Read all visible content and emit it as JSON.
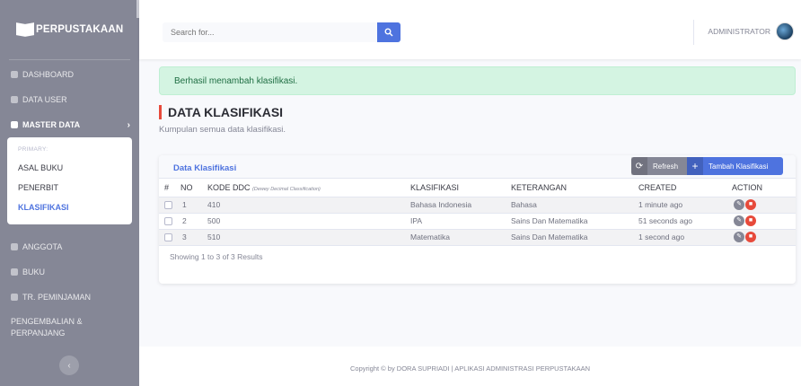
{
  "brand": {
    "title": "PERPUSTAKAAN"
  },
  "sidebar": {
    "items": [
      {
        "label": "DASHBOARD"
      },
      {
        "label": "DATA USER"
      },
      {
        "label": "MASTER DATA"
      },
      {
        "label": "ANGGOTA"
      },
      {
        "label": "BUKU"
      },
      {
        "label": "TR. PEMINJAMAN"
      },
      {
        "label": "PENGEMBALIAN & PERPANJANG"
      }
    ],
    "submenu": {
      "header": "PRIMARY:",
      "items": [
        {
          "label": "ASAL BUKU"
        },
        {
          "label": "PENERBIT"
        },
        {
          "label": "KLASIFIKASI"
        }
      ]
    }
  },
  "topbar": {
    "search_placeholder": "Search for...",
    "user_name": "ADMINISTRATOR"
  },
  "alert": {
    "message": "Berhasil menambah klasifikasi."
  },
  "page": {
    "title": "DATA KLASIFIKASI",
    "subtitle": "Kumpulan semua data klasifikasi."
  },
  "card": {
    "title": "Data Klasifikasi",
    "refresh_label": "Refresh",
    "add_label": "Tambah Klasifikasi"
  },
  "table": {
    "headers": {
      "hash": "#",
      "no": "NO",
      "kode": "KODE DDC",
      "kode_note": "(Dewey Decimal Classification)",
      "klasifikasi": "KLASIFIKASI",
      "keterangan": "KETERANGAN",
      "created": "CREATED",
      "action": "ACTION"
    },
    "rows": [
      {
        "no": "1",
        "kode": "410",
        "klasifikasi": "Bahasa Indonesia",
        "keterangan": "Bahasa",
        "created": "1 minute ago"
      },
      {
        "no": "2",
        "kode": "500",
        "klasifikasi": "IPA",
        "keterangan": "Sains Dan Matematika",
        "created": "51 seconds ago"
      },
      {
        "no": "3",
        "kode": "510",
        "klasifikasi": "Matematika",
        "keterangan": "Sains Dan Matematika",
        "created": "1 second ago"
      }
    ],
    "footer": "Showing 1 to 3 of 3 Results"
  },
  "footer": {
    "copyright": "Copyright © by DORA SUPRIADI | APLIKASI ADMINISTRASI PERPUSTAKAAN"
  },
  "colors": {
    "primary": "#4e73df",
    "sidebar": "#858796",
    "danger": "#e74a3b",
    "success_bg": "#d4f4e2"
  }
}
